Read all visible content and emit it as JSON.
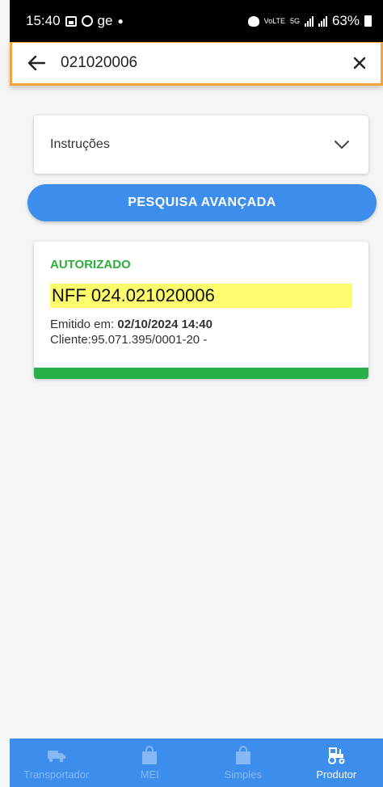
{
  "status_bar": {
    "time": "15:40",
    "carrier_text": "ge",
    "small_text": "VoLTE",
    "network": "5G",
    "battery": "63%"
  },
  "search": {
    "value": "021020006",
    "back_icon": "arrow-left-icon",
    "clear_icon": "close-icon"
  },
  "instructions": {
    "label": "Instruções",
    "icon": "chevron-down-icon"
  },
  "advanced_search": {
    "label": "PESQUISA AVANÇADA"
  },
  "result": {
    "status": "AUTORIZADO",
    "nf_number": "NFF 024.021020006",
    "emitted_label": "Emitido em: ",
    "emitted_value": "02/10/2024 14:40",
    "client_text": "Cliente:95.071.395/0001-20 -",
    "colors": {
      "status": "#2eac3c",
      "highlight": "#fdfc6c",
      "strip": "#28b048"
    }
  },
  "bottom_nav": {
    "items": [
      {
        "label": "Transportador",
        "icon": "truck-icon",
        "active": false
      },
      {
        "label": "MEI",
        "icon": "shopping-bag-icon",
        "active": false
      },
      {
        "label": "Simples",
        "icon": "shopping-bag-icon",
        "active": false
      },
      {
        "label": "Produtor",
        "icon": "tractor-icon",
        "active": true
      }
    ],
    "color": "#3d8ded"
  }
}
